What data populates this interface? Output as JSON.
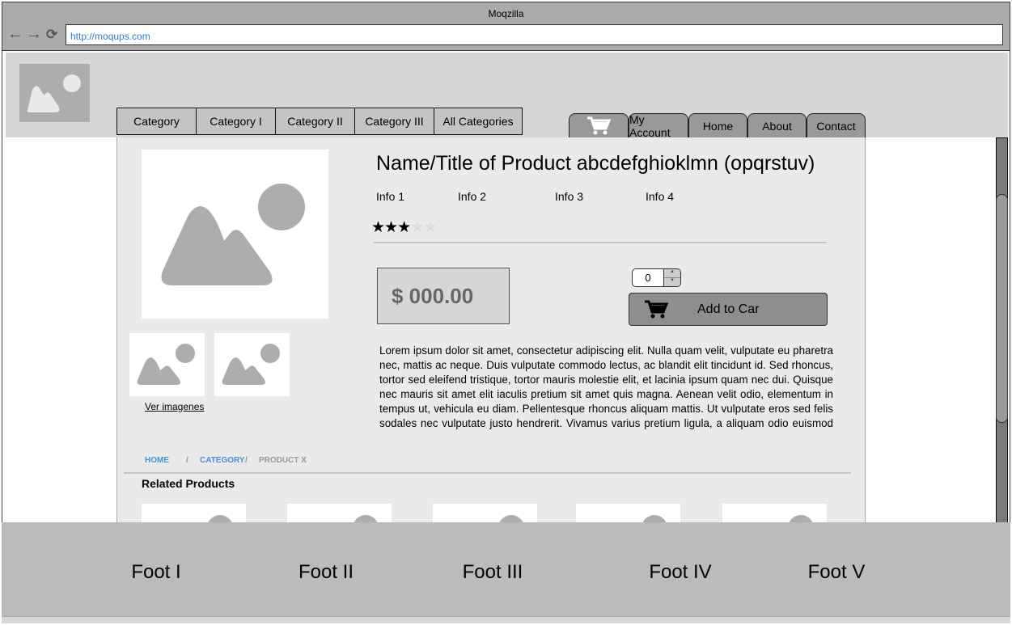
{
  "browser": {
    "title": "Moqzilla",
    "url": "http://moqups.com",
    "icons": [
      "back-arrow-icon",
      "forward-arrow-icon",
      "reload-icon"
    ]
  },
  "categories": [
    "Category",
    "Category I",
    "Category II",
    "Category III",
    "All Categories"
  ],
  "tabs": {
    "cart_icon": "cart-icon",
    "items": [
      "My Account",
      "Home",
      "About",
      "Contact"
    ]
  },
  "product": {
    "title": "Name/Title of Product abcdefghioklmn (opqrstuv)",
    "info": [
      "Info 1",
      "Info 2",
      "Info 3",
      "Info 4"
    ],
    "rating": 3,
    "rating_max": 5,
    "price": "$ 000.00",
    "quantity": "0",
    "add_to_cart": "Add to Car",
    "see_images": "Ver imagenes",
    "description": "Lorem ipsum dolor sit amet, consectetur adipiscing elit. Nulla quam velit, vulputate eu pharetra nec, mattis ac neque. Duis vulputate commodo lectus, ac blandit elit tincidunt id. Sed rhoncus, tortor sed eleifend tristique, tortor mauris molestie elit, et lacinia ipsum quam nec dui. Quisque nec mauris sit amet elit iaculis pretium sit amet quis magna. Aenean velit odio, elementum in tempus ut, vehicula eu diam. Pellentesque rhoncus aliquam mattis. Ut vulputate eros sed felis sodales nec vulputate justo hendrerit. Vivamus varius pretium ligula, a aliquam odio euismod sit amet."
  },
  "breadcrumb": {
    "home": "HOME",
    "sep": "/",
    "category": "CATEGORY",
    "current": "PRODUCT X"
  },
  "related": {
    "title": "Related Products"
  },
  "footer": [
    "Foot I",
    "Foot II",
    "Foot III",
    "Foot IV",
    "Foot V"
  ],
  "colors": {
    "link": "#4a90d9",
    "breadcrumb_current": "#999999"
  }
}
